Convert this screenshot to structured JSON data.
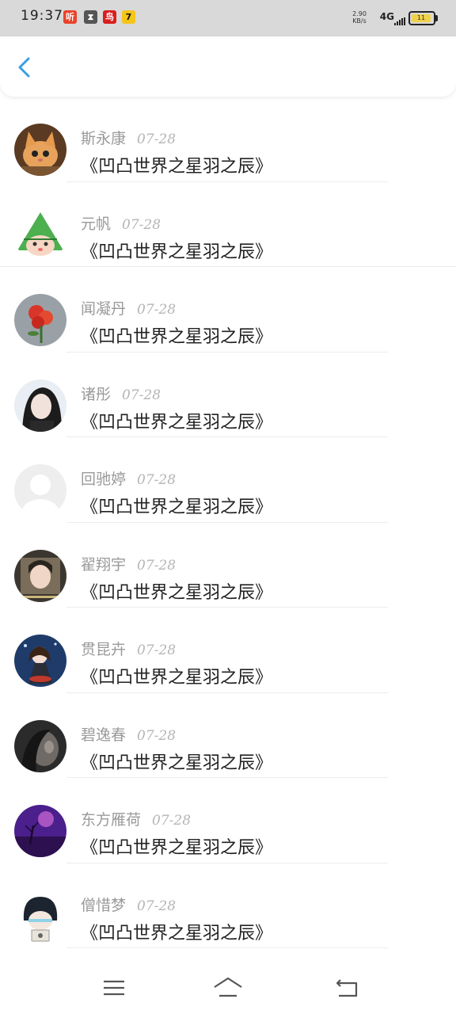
{
  "status_bar": {
    "time": "19:37",
    "net_speed": "2.90",
    "net_speed_unit": "KB/s",
    "network": "4G",
    "battery": "11"
  },
  "notifications": [
    {
      "icon": "app-notification-icon",
      "glyph": "听",
      "color": "#e8442b"
    },
    {
      "icon": "hourglass-notification-icon",
      "glyph": "⧗",
      "color": "#555555"
    },
    {
      "icon": "bird-notification-icon",
      "glyph": "鸟",
      "color": "#d81e1e"
    },
    {
      "icon": "app7-notification-icon",
      "glyph": "7",
      "color": "#f5c518"
    }
  ],
  "header": {
    "back_icon": "chevron-left-icon",
    "accent": "#3a9ee4"
  },
  "comments": [
    {
      "name": "斯永康",
      "date": "07-28",
      "text": "《凹凸世界之星羽之辰》",
      "avatar": "cat-avatar"
    },
    {
      "name": "元帆",
      "date": "07-28",
      "text": "《凹凸世界之星羽之辰》",
      "avatar": "zongzi-avatar"
    },
    {
      "name": "闻凝丹",
      "date": "07-28",
      "text": "《凹凸世界之星羽之辰》",
      "avatar": "rose-avatar"
    },
    {
      "name": "诸彤",
      "date": "07-28",
      "text": "《凹凸世界之星羽之辰》",
      "avatar": "girl-avatar"
    },
    {
      "name": "回驰婷",
      "date": "07-28",
      "text": "《凹凸世界之星羽之辰》",
      "avatar": "default-avatar"
    },
    {
      "name": "翟翔宇",
      "date": "07-28",
      "text": "《凹凸世界之星羽之辰》",
      "avatar": "selfie-avatar"
    },
    {
      "name": "贯昆卉",
      "date": "07-28",
      "text": "《凹凸世界之星羽之辰》",
      "avatar": "anime-avatar"
    },
    {
      "name": "碧逸春",
      "date": "07-28",
      "text": "《凹凸世界之星羽之辰》",
      "avatar": "dark-portrait-avatar"
    },
    {
      "name": "东方雁荷",
      "date": "07-28",
      "text": "《凹凸世界之星羽之辰》",
      "avatar": "purple-tree-avatar"
    },
    {
      "name": "僧惜梦",
      "date": "07-28",
      "text": "《凹凸世界之星羽之辰》",
      "avatar": "cartoon-avatar"
    }
  ],
  "nav_bar": {
    "menu_icon": "menu-icon",
    "home_icon": "home-icon",
    "back_icon": "back-arrow-icon"
  }
}
